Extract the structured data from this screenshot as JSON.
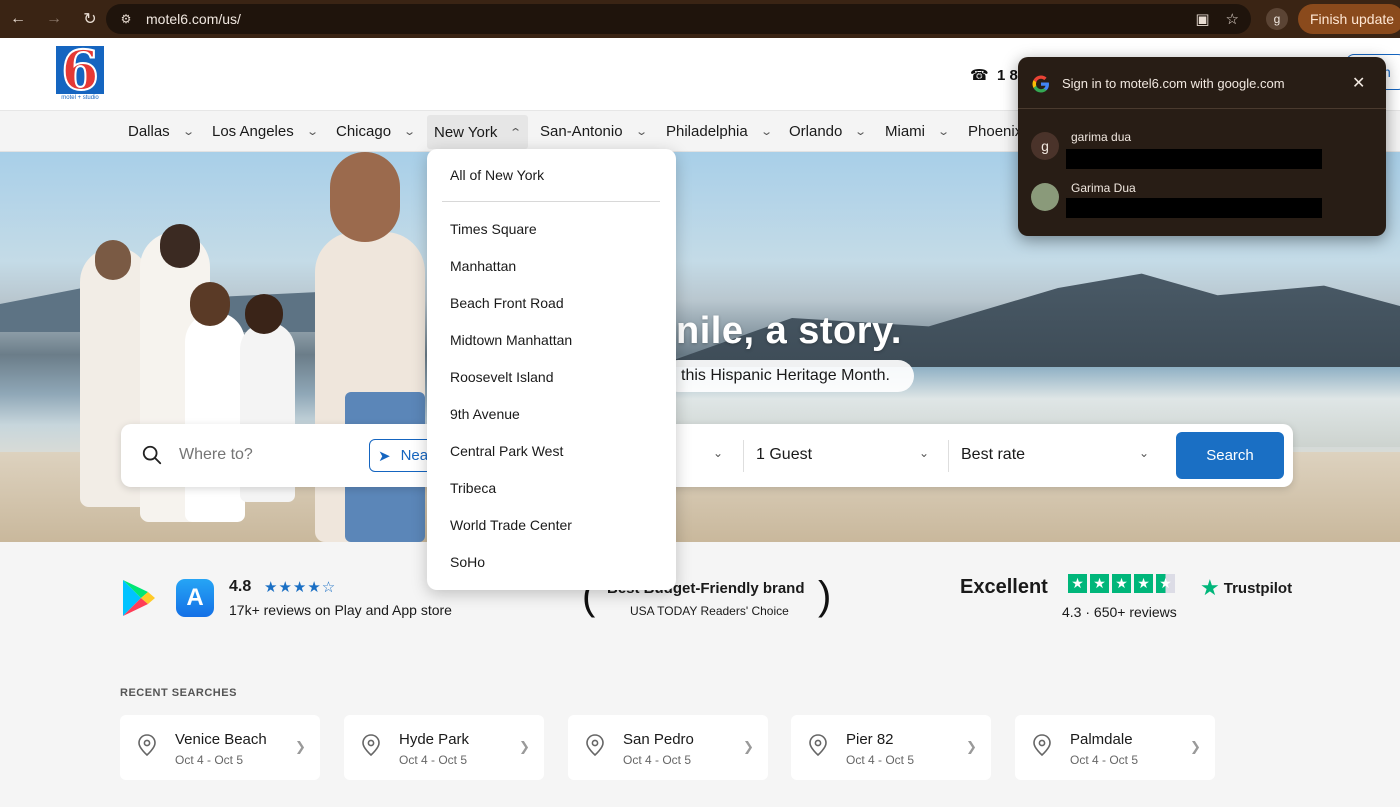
{
  "browser": {
    "url": "motel6.com/us/",
    "profile_initial": "g",
    "finish_update_label": "Finish update"
  },
  "header": {
    "logo_text": "6",
    "logo_tagline": "motel + studio",
    "phone_text": "1 8",
    "signin_fragment": "n"
  },
  "city_nav": [
    {
      "label": "Dallas"
    },
    {
      "label": "Los Angeles"
    },
    {
      "label": "Chicago"
    },
    {
      "label": "New York"
    },
    {
      "label": "San-Antonio"
    },
    {
      "label": "Philadelphia"
    },
    {
      "label": "Orlando"
    },
    {
      "label": "Miami"
    },
    {
      "label": "Phoenix"
    }
  ],
  "dropdown": {
    "all_label": "All of New York",
    "items": [
      "Times Square",
      "Manhattan",
      "Beach Front Road",
      "Midtown Manhattan",
      "Roosevelt Island",
      "9th Avenue",
      "Central Park West",
      "Tribeca",
      "World Trade Center",
      "SoHo"
    ]
  },
  "hero": {
    "title_fragment": "nile, a story.",
    "pill_fragment": "this Hispanic Heritage Month."
  },
  "search": {
    "where_placeholder": "Where to?",
    "near_label": "Nea",
    "guests": "1 Guest",
    "rate": "Best rate",
    "button_label": "Search"
  },
  "ratings": {
    "app_rating": "4.8",
    "app_reviews": "17k+ reviews on Play and App store",
    "brand_title": "Best Budget-Friendly brand",
    "brand_sub": "USA TODAY Readers' Choice",
    "tp_label": "Excellent",
    "tp_score": "4.3 · 650+ reviews",
    "tp_brand": "Trustpilot"
  },
  "recent": {
    "label": "RECENT SEARCHES",
    "items": [
      {
        "title": "Venice Beach",
        "dates": "Oct 4 - Oct 5"
      },
      {
        "title": "Hyde Park",
        "dates": "Oct 4 - Oct 5"
      },
      {
        "title": "San Pedro",
        "dates": "Oct 4 - Oct 5"
      },
      {
        "title": "Pier 82",
        "dates": "Oct 4 - Oct 5"
      },
      {
        "title": "Palmdale",
        "dates": "Oct 4 - Oct 5"
      }
    ]
  },
  "google_popup": {
    "title": "Sign in to motel6.com with google.com",
    "accounts": [
      {
        "initial": "g",
        "name": "garima dua"
      },
      {
        "initial": "",
        "name": "Garima Dua"
      }
    ]
  },
  "colors": {
    "accent": "#1a6fc4",
    "logo_red": "#e53935",
    "trustpilot_green": "#00b67a",
    "chrome_bg": "#3a2414"
  }
}
